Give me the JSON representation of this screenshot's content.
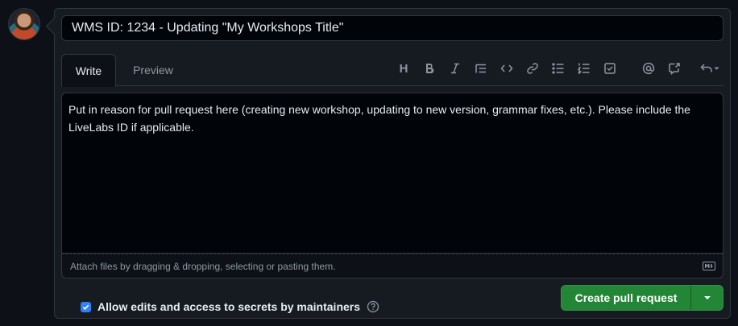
{
  "title_field": {
    "value": "WMS ID: 1234 - Updating \"My Workshops Title\""
  },
  "tabs": [
    {
      "label": "Write"
    },
    {
      "label": "Preview"
    }
  ],
  "toolbar": {
    "heading_glyph": "H",
    "icons": [
      "bold-icon",
      "italic-icon",
      "quote-icon",
      "code-icon",
      "link-icon",
      "unordered-list-icon",
      "ordered-list-icon",
      "task-list-icon",
      "mention-icon",
      "cross-reference-icon",
      "reply-icon"
    ]
  },
  "body": {
    "text": "Put in reason for pull request here (creating new workshop, updating to new version, grammar fixes, etc.). Please include the LiveLabs ID if applicable."
  },
  "attach_hint": "Attach files by dragging & dropping, selecting or pasting them.",
  "maintainer_option": {
    "label": "Allow edits and access to secrets by maintainers",
    "checked": true
  },
  "submit": {
    "label": "Create pull request"
  },
  "colors": {
    "accent_green": "#238636",
    "checkbox_blue": "#2f81f7",
    "background": "#0d1117"
  }
}
